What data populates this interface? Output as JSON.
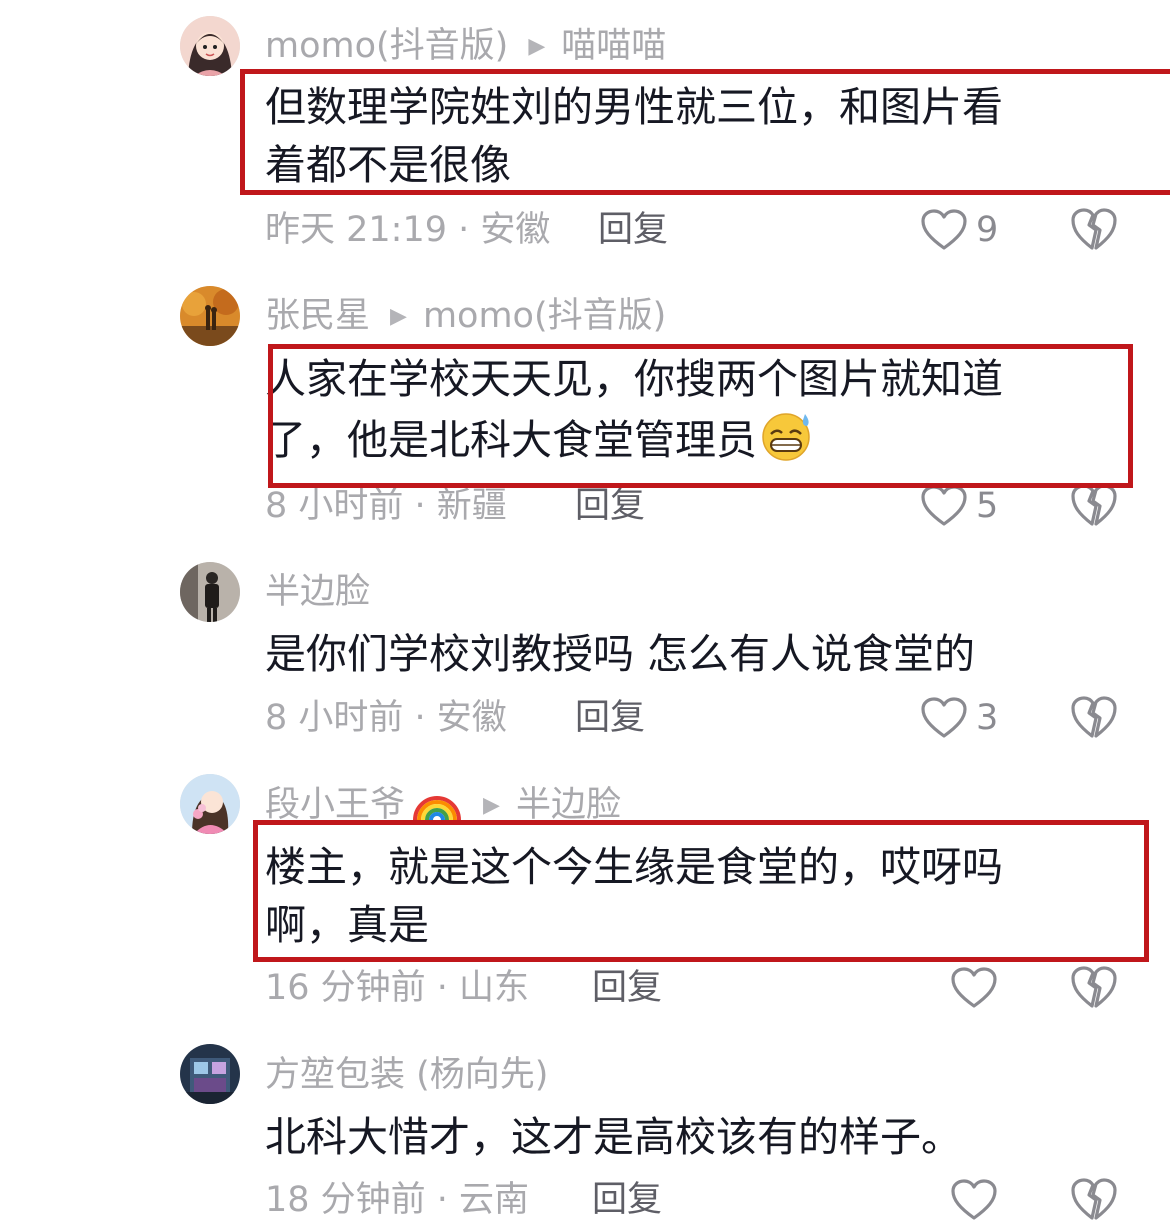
{
  "comments": [
    {
      "author": "momo(抖音版)",
      "reply_to": "喵喵喵",
      "text": "但数理学院姓刘的男性就三位，和图片看\n着都不是很像",
      "time_location": "昨天 21:19 · 安徽",
      "reply_label": "回复",
      "likes": "9"
    },
    {
      "author": "张民星",
      "reply_to": "momo(抖音版)",
      "text": "人家在学校天天见，你搜两个图片就知道\n了，他是北科大食堂管理员",
      "time_location": "8 小时前 · 新疆",
      "reply_label": "回复",
      "likes": "5"
    },
    {
      "author": "半边脸",
      "reply_to": "",
      "text": "是你们学校刘教授吗 怎么有人说食堂的",
      "time_location": "8 小时前 · 安徽",
      "reply_label": "回复",
      "likes": "3"
    },
    {
      "author": "段小王爷",
      "reply_to": "半边脸",
      "text": "楼主，就是这个今生缘是食堂的，哎呀吗\n啊，真是",
      "time_location": "16 分钟前 · 山东",
      "reply_label": "回复",
      "likes": ""
    },
    {
      "author": "方堃包装 (杨向先)",
      "reply_to": "",
      "text": "北科大惜才，这才是高校该有的样子。",
      "time_location": "18 分钟前 · 云南",
      "reply_label": "回复",
      "likes": ""
    }
  ],
  "icons": {
    "like": "heart-outline-icon",
    "dislike": "broken-heart-icon",
    "reply_arrow": "play-triangle-icon",
    "emoji": "grinning-sweat-emoji",
    "rainbow": "rainbow-emoji"
  },
  "colors": {
    "highlight_border": "#c0171b",
    "author": "#a9a9ad",
    "text": "#161823"
  }
}
